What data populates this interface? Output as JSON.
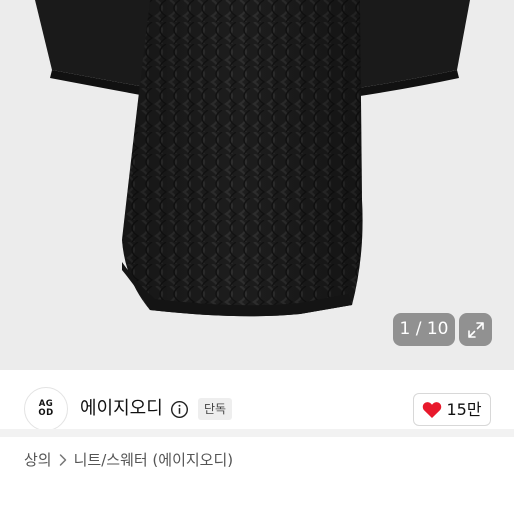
{
  "gallery": {
    "counter_text": "1 / 10",
    "expand_icon": "expand-arrows-icon",
    "background_color": "#ececec",
    "garment_color": "#1c1c1c"
  },
  "shop": {
    "logo_text_top": "AG",
    "logo_text_bottom": "OD",
    "name": "에이지오디",
    "info_icon": "info-circle-icon",
    "badge": "단독"
  },
  "like": {
    "icon": "heart-icon",
    "icon_color": "#e8192c",
    "count": "15만"
  },
  "breadcrumb": {
    "category": "상의",
    "separator_icon": "chevron-right-icon",
    "subcategory": "니트/스웨터 (에이지오디)"
  }
}
